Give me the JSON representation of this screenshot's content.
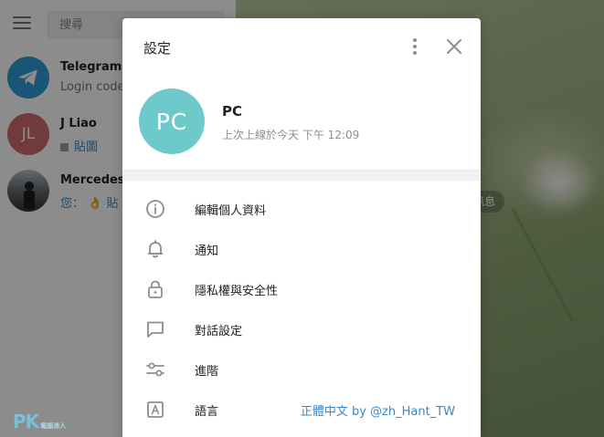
{
  "sidebar": {
    "search_placeholder": "搜尋",
    "chats": [
      {
        "name": "Telegram",
        "preview": "Login code:",
        "avatar_color": "#2f9bd6"
      },
      {
        "name": "J Liao",
        "initials": "JL",
        "preview": "貼圖",
        "avatar_color": "#d26a6e"
      },
      {
        "name": "Mercedes L",
        "preview_prefix": "您：",
        "preview_emoji": "👌",
        "preview": "貼",
        "avatar_color": "#5a5a5a"
      }
    ]
  },
  "main": {
    "message_pill": "訊息"
  },
  "settings": {
    "title": "設定",
    "profile": {
      "initials": "PC",
      "name": "PC",
      "status": "上次上線於今天 下午",
      "time": "12:09",
      "avatar_color": "#6ec9cb"
    },
    "menu": [
      {
        "label": "編輯個人資料",
        "icon": "info-icon"
      },
      {
        "label": "通知",
        "icon": "bell-icon"
      },
      {
        "label": "隱私權與安全性",
        "icon": "lock-icon"
      },
      {
        "label": "對話設定",
        "icon": "chat-bubble-icon"
      },
      {
        "label": "進階",
        "icon": "sliders-icon"
      },
      {
        "label": "語言",
        "icon": "language-icon",
        "value": "正體中文 by @zh_Hant_TW"
      }
    ]
  },
  "watermark": {
    "logo": "PK",
    "sub": "電腦達人"
  },
  "colors": {
    "accent": "#3a88c9",
    "icon": "#8a8f93"
  }
}
